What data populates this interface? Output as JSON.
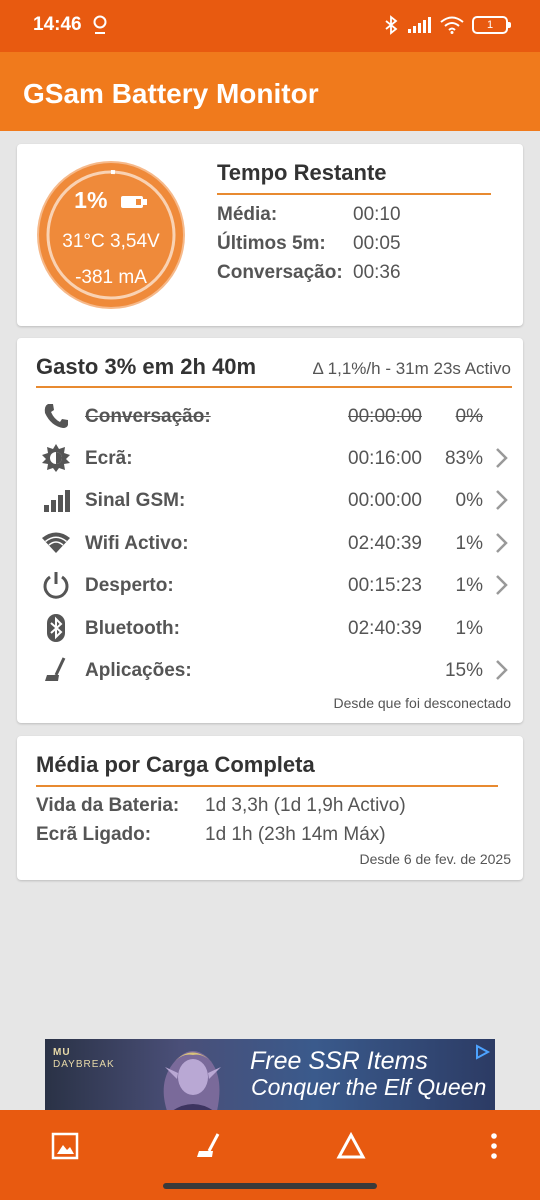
{
  "status_bar": {
    "time": "14:46",
    "battery_level": "1"
  },
  "app": {
    "title": "GSam Battery Monitor",
    "accent_color": "#f07a1c"
  },
  "gauge": {
    "percent": "1%",
    "temp_voltage": "31°C  3,54V",
    "current": "-381 mA",
    "level_fraction": 0.01
  },
  "time_remaining": {
    "title": "Tempo Restante",
    "rows": [
      {
        "label": "Média:",
        "value": "00:10"
      },
      {
        "label": "Últimos 5m:",
        "value": "00:05"
      },
      {
        "label": "Conversação:",
        "value": "00:36"
      }
    ]
  },
  "usage": {
    "title": "Gasto 3% em 2h 40m",
    "rate": "Δ 1,1%/h - 31m 23s Activo",
    "rows": [
      {
        "icon": "phone-icon",
        "label": "Conversação:",
        "time": "00:00:00",
        "pct": "0%",
        "struck": true,
        "chevron": false
      },
      {
        "icon": "screen-brightness-icon",
        "label": "Ecrã:",
        "time": "00:16:00",
        "pct": "83%",
        "struck": false,
        "chevron": true
      },
      {
        "icon": "signal-bars-icon",
        "label": "Sinal GSM:",
        "time": "00:00:00",
        "pct": "0%",
        "struck": false,
        "chevron": true
      },
      {
        "icon": "wifi-icon",
        "label": "Wifi Activo:",
        "time": "02:40:39",
        "pct": "1%",
        "struck": false,
        "chevron": true
      },
      {
        "icon": "power-icon",
        "label": "Desperto:",
        "time": "00:15:23",
        "pct": "1%",
        "struck": false,
        "chevron": true
      },
      {
        "icon": "bluetooth-icon",
        "label": "Bluetooth:",
        "time": "02:40:39",
        "pct": "1%",
        "struck": false,
        "chevron": false
      },
      {
        "icon": "broom-icon",
        "label": "Aplicações:",
        "time": "",
        "pct": "15%",
        "struck": false,
        "chevron": true
      }
    ],
    "footer": "Desde que foi desconectado"
  },
  "full_charge": {
    "title": "Média por Carga Completa",
    "rows": [
      {
        "label": "Vida da Bateria:",
        "value": "1d 3,3h (1d 1,9h Activo)"
      },
      {
        "label": "Ecrã Ligado:",
        "value": "1d 1h (23h 14m Máx)"
      }
    ],
    "footer": "Desde 6 de fev. de 2025"
  },
  "ad": {
    "brand_line1": "MU",
    "brand_line2": "DAYBREAK",
    "line1": "Free SSR Items",
    "line2": "Conquer the Elf Queen"
  },
  "bottom_nav": [
    {
      "icon": "image-icon"
    },
    {
      "icon": "broom-icon"
    },
    {
      "icon": "delta-icon"
    },
    {
      "icon": "more-vert-icon"
    }
  ]
}
